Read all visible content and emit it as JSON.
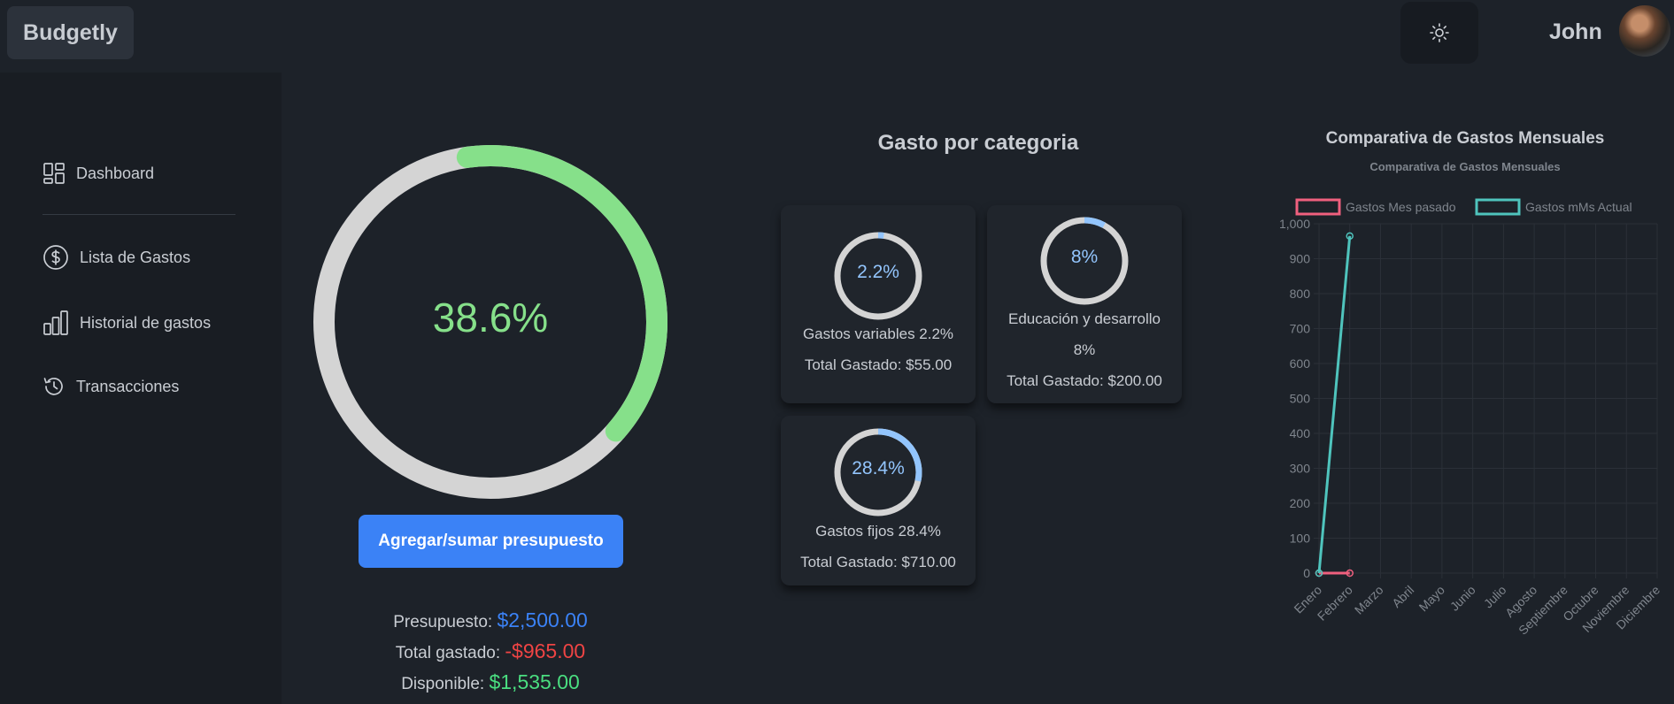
{
  "app": {
    "brand": "Budgetly",
    "user_name": "John"
  },
  "icons": {
    "theme": "sun-icon",
    "avatar": "avatar"
  },
  "sidebar": {
    "items": [
      {
        "label": "Dashboard",
        "icon": "dashboard-icon"
      },
      {
        "label": "Lista de Gastos",
        "icon": "dollar-circle-icon"
      },
      {
        "label": "Historial de gastos",
        "icon": "bar-chart-icon"
      },
      {
        "label": "Transacciones",
        "icon": "history-icon"
      }
    ]
  },
  "budget": {
    "percent_label": "38.6%",
    "percent_value": 38.6,
    "add_button": "Agregar/sumar presupuesto",
    "presupuesto_label": "Presupuesto:",
    "presupuesto_value": "$2,500.00",
    "gastado_label": "Total gastado:",
    "gastado_value": "-$965.00",
    "disponible_label": "Disponible:",
    "disponible_value": "$1,535.00"
  },
  "categories": {
    "title": "Gasto por categoria",
    "items": [
      {
        "percent": 2.2,
        "percent_label": "2.2%",
        "name_line1": "Gastos variables 2.2%",
        "name_line2": "",
        "total": "Total Gastado: $55.00"
      },
      {
        "percent": 8,
        "percent_label": "8%",
        "name_line1": "Educación y desarrollo",
        "name_line2": "8%",
        "total": "Total Gastado: $200.00"
      },
      {
        "percent": 28.4,
        "percent_label": "28.4%",
        "name_line1": "Gastos fijos 28.4%",
        "name_line2": "",
        "total": "Total Gastado: $710.00"
      }
    ]
  },
  "chart_data": {
    "type": "line",
    "title": "Comparativa de Gastos Mensuales",
    "subtitle": "Comparativa de Gastos Mensuales",
    "legend_position": "top",
    "categories": [
      "Enero",
      "Febrero",
      "Marzo",
      "Abril",
      "Mayo",
      "Junio",
      "Julio",
      "Agosto",
      "Septiembre",
      "Octubre",
      "Noviembre",
      "Diciembre"
    ],
    "ylim": [
      0,
      1000
    ],
    "yticks": [
      0,
      100,
      200,
      300,
      400,
      500,
      600,
      700,
      800,
      900,
      1000
    ],
    "ytick_labels": [
      "0",
      "100",
      "200",
      "300",
      "400",
      "500",
      "600",
      "700",
      "800",
      "900",
      "1,000"
    ],
    "grid": true,
    "series": [
      {
        "name": "Gastos Mes pasado",
        "color": "#f0607e",
        "values": [
          0,
          0
        ]
      },
      {
        "name": "Gastos mMs Actual",
        "color": "#4fc4bd",
        "values": [
          0,
          965
        ]
      }
    ]
  },
  "colors": {
    "accent_green": "#86e08a",
    "ring_track": "#d4d4d4",
    "accent_blue": "#3b82f6",
    "negative_red": "#ef4444",
    "positive_green": "#4ade80",
    "category_ring": "#93c5fd"
  }
}
